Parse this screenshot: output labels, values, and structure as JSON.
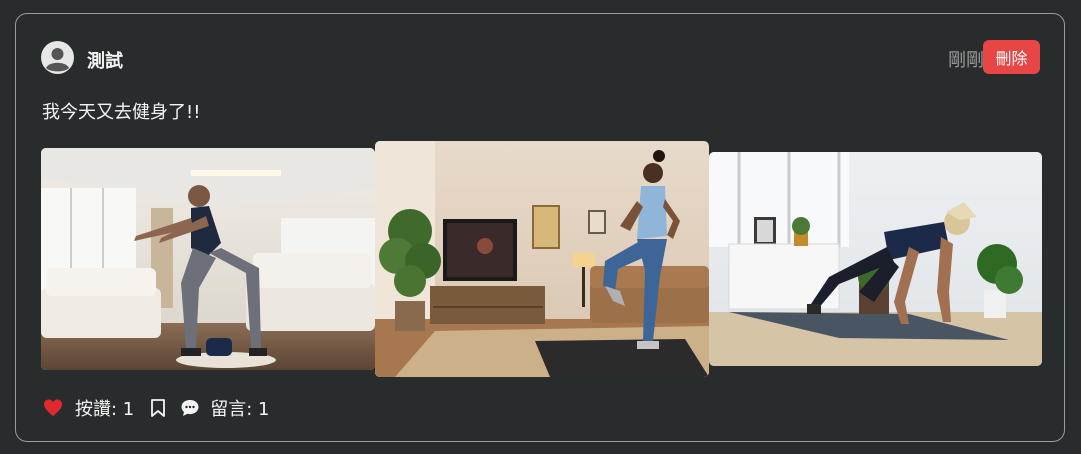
{
  "post": {
    "author": "測試",
    "time": "剛剛",
    "delete_label": "刪除",
    "content": "我今天又去健身了!!"
  },
  "photos": [
    {
      "alt_icon": "photo-squat-man"
    },
    {
      "alt_icon": "photo-high-knee-woman"
    },
    {
      "alt_icon": "photo-mountain-climber-woman"
    }
  ],
  "actions": {
    "like_label": "按讚: 1",
    "comment_label": "留言: 1"
  },
  "colors": {
    "background": "#292c2d",
    "delete": "#e84545",
    "heart": "#e0282e",
    "muted_text": "#9b9b9b"
  }
}
